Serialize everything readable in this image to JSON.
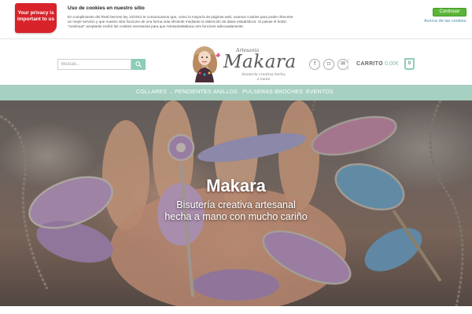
{
  "cookie_bar": {
    "privacy_badge": "Your privacy is important to us",
    "title": "Uso de cookies en nuestro sitio",
    "text": "En cumplimiento del Real Decreto ley 13/2012 te comunicamos que, como la mayoría de páginas web, usamos cookies para poder ofrecerte un mejor servicio y que nuestro sitio funcione de una forma más eficiente mediante la obtención de datos estadísticos. Si pulsas el botón \"continuar\" aceptarás recibir las cookies necesarias para que ArtesaniaMakara.com funcione adecuadamente.",
    "continue_label": "Continuar",
    "more_label": "Acerca de las cookies",
    "badge_color": "#d8232a",
    "button_color": "#5cb53a"
  },
  "header": {
    "search_placeholder": "Buscar...",
    "search_icon": "search-icon",
    "logo": {
      "small_text": "Artesanía",
      "name": "Makara",
      "tagline": "bisutería creativa hecha a mano"
    },
    "social": [
      {
        "icon": "facebook-icon",
        "glyph": "f"
      },
      {
        "icon": "instagram-icon",
        "glyph": "◘"
      },
      {
        "icon": "email-icon",
        "glyph": "✉"
      }
    ],
    "cart_label": "CARRITO",
    "cart_separator": "/",
    "cart_total": "0,00€",
    "cart_count": "0",
    "accent_color": "#8dcdb9"
  },
  "nav": {
    "items": [
      "COLLARES",
      "PENDIENTES",
      "ANILLOS",
      "PULSERAS",
      "BROCHES",
      "EVENTOS"
    ],
    "dropdown_indicator": "⌄",
    "background": "#a6d0c1"
  },
  "hero": {
    "title": "Makara",
    "subtitle_line1": "Bisutería creativa artesanal",
    "subtitle_line2": "hecha a mano con mucho cariño"
  }
}
